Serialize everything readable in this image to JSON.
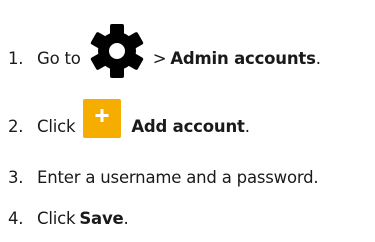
{
  "steps": [
    {
      "number": "1.",
      "prefix": "Go to",
      "icon": "gear-icon",
      "separator": ">",
      "target": "Admin accounts",
      "suffix": "."
    },
    {
      "number": "2.",
      "prefix": "Click",
      "icon": "plus-icon",
      "target": "Add account",
      "suffix": "."
    },
    {
      "number": "3.",
      "text": "Enter a username and a password."
    },
    {
      "number": "4.",
      "prefix": "Click",
      "target": "Save",
      "suffix": "."
    }
  ],
  "colors": {
    "text": "#1a1a1a",
    "icon_dark": "#000000",
    "button_accent": "#f5ad00",
    "button_symbol": "#ffffff"
  }
}
